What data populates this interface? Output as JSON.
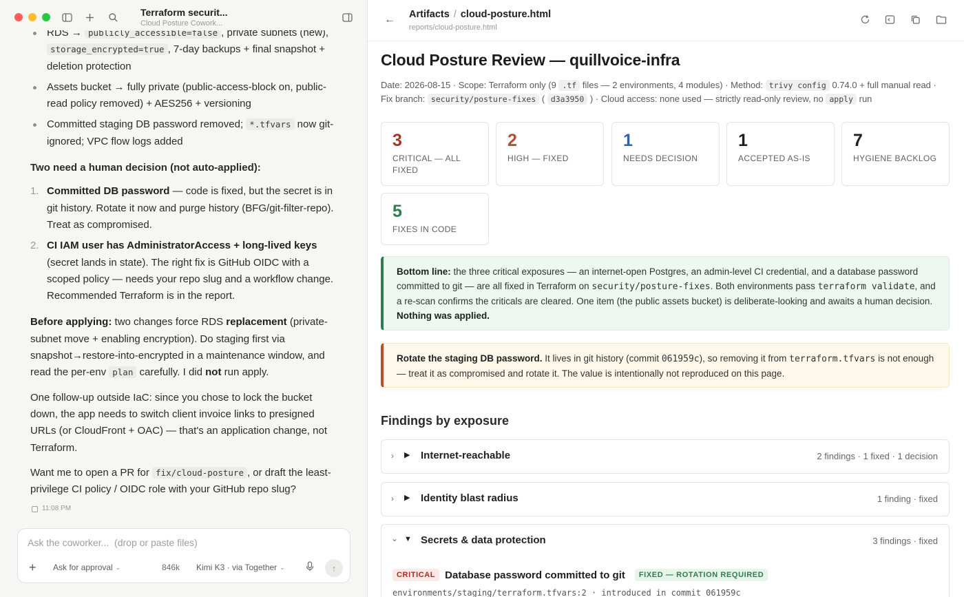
{
  "window": {
    "chat_title": "Terraform securit...",
    "chat_subtitle": "Cloud Posture Cowork..."
  },
  "transcript": {
    "bullet1": {
      "pre": "RDS → ",
      "code1": "publicly_accessible=false",
      "mid": ", private subnets (new), ",
      "code2": "storage_encrypted=true",
      "post": ", 7-day backups + final snapshot + deletion protection"
    },
    "bullet2": "Assets bucket → fully private (public-access-block on, public-read policy removed) + AES256 + versioning",
    "bullet3": {
      "pre": "Committed staging DB password removed; ",
      "code": "*.tfvars",
      "post": " now git-ignored; VPC flow logs added"
    },
    "decision_heading": "Two need a human decision (not auto-applied):",
    "decisions": [
      {
        "num": "1.",
        "bold": "Committed DB password",
        "rest": " — code is fixed, but the secret is in git history. Rotate it now and purge history (BFG/git-filter-repo). Treat as compromised."
      },
      {
        "num": "2.",
        "bold": "CI IAM user has AdministratorAccess + long-lived keys",
        "rest": " (secret lands in state). The right fix is GitHub OIDC with a scoped policy — needs your repo slug and a workflow change. Recommended Terraform is in the report."
      }
    ],
    "before": {
      "b1": "Before applying:",
      "t1": " two changes force RDS ",
      "b2": "replacement",
      "t2": " (private-subnet move + enabling encryption). Do staging first via snapshot→restore-into-encrypted in a maintenance window, and read the per-env ",
      "code": "plan",
      "t3": " carefully. I did ",
      "b3": "not",
      "t4": " run apply."
    },
    "followup": "One follow-up outside IaC: since you chose to lock the bucket down, the app needs to switch client invoice links to presigned URLs (or CloudFront + OAC) — that's an application change, not Terraform.",
    "ask": {
      "pre": "Want me to open a PR for ",
      "code": "fix/cloud-posture",
      "post": ", or draft the least-privilege CI policy / OIDC role with your GitHub repo slug?"
    },
    "timestamp": "11:08 PM"
  },
  "composer": {
    "placeholder": "Ask the coworker...  (drop or paste files)",
    "approval": "Ask for approval",
    "tokens": "846k",
    "model": "Kimi K3 · via Together"
  },
  "artifact": {
    "crumb_root": "Artifacts",
    "crumb_file": "cloud-posture.html",
    "path": "reports/cloud-posture.html"
  },
  "doc": {
    "title": "Cloud Posture Review — quillvoice-infra",
    "meta": {
      "t1": "Date: 2026-08-15 · Scope: Terraform only (9 ",
      "c1": ".tf",
      "t2": " files — 2 environments, 4 modules) · Method: ",
      "c2": "trivy config",
      "t3": " 0.74.0 + full manual read · Fix branch: ",
      "c3": "security/posture-fixes",
      "t4": " ( ",
      "c4": "d3a3950",
      "t5": " ) · Cloud access: none used — strictly read-only review, no ",
      "c5": "apply",
      "t6": " run"
    },
    "stats": [
      {
        "value": "3",
        "label": "Critical — all fixed",
        "color": "#a8322a"
      },
      {
        "value": "2",
        "label": "High — fixed",
        "color": "#b5502c"
      },
      {
        "value": "1",
        "label": "Needs decision",
        "color": "#2f5fb3"
      },
      {
        "value": "1",
        "label": "Accepted as-is",
        "color": "#1f1f1f"
      },
      {
        "value": "7",
        "label": "Hygiene backlog",
        "color": "#1f1f1f"
      },
      {
        "value": "5",
        "label": "Fixes in code",
        "color": "#2e7d4f"
      }
    ],
    "bottom_line": {
      "lead": "Bottom line:",
      "t1": " the three critical exposures — an internet-open Postgres, an admin-level CI credential, and a database password committed to git — are all fixed in Terraform on ",
      "m1": "security/posture-fixes",
      "t2": ". Both environments pass ",
      "m2": "terraform validate",
      "t3": ", and a re-scan confirms the criticals are cleared. One item (the public assets bucket) is deliberate-looking and awaits a human decision. ",
      "tail": "Nothing was applied."
    },
    "rotate": {
      "lead": "Rotate the staging DB password.",
      "t1": " It lives in git history (commit ",
      "m1": "061959c",
      "t2": "), so removing it from ",
      "m2": "terraform.tfvars",
      "t3": " is not enough — treat it as compromised and rotate it. The value is intentionally not reproduced on this page."
    },
    "findings_heading": "Findings by exposure",
    "groups": [
      {
        "name": "Internet-reachable",
        "summary": "2 findings · 1 fixed · 1 decision",
        "chev": "›",
        "tri": "▶"
      },
      {
        "name": "Identity blast radius",
        "summary": "1 finding · fixed",
        "chev": "›",
        "tri": "▶"
      },
      {
        "name": "Secrets & data protection",
        "summary": "3 findings · fixed",
        "chev": "⌄",
        "tri": "▼"
      }
    ],
    "detail": {
      "severity": "CRITICAL",
      "title": "Database password committed to git",
      "status": "FIXED — ROTATION REQUIRED",
      "location": "environments/staging/terraform.tfvars:2 · introduced in commit 061959c"
    }
  }
}
